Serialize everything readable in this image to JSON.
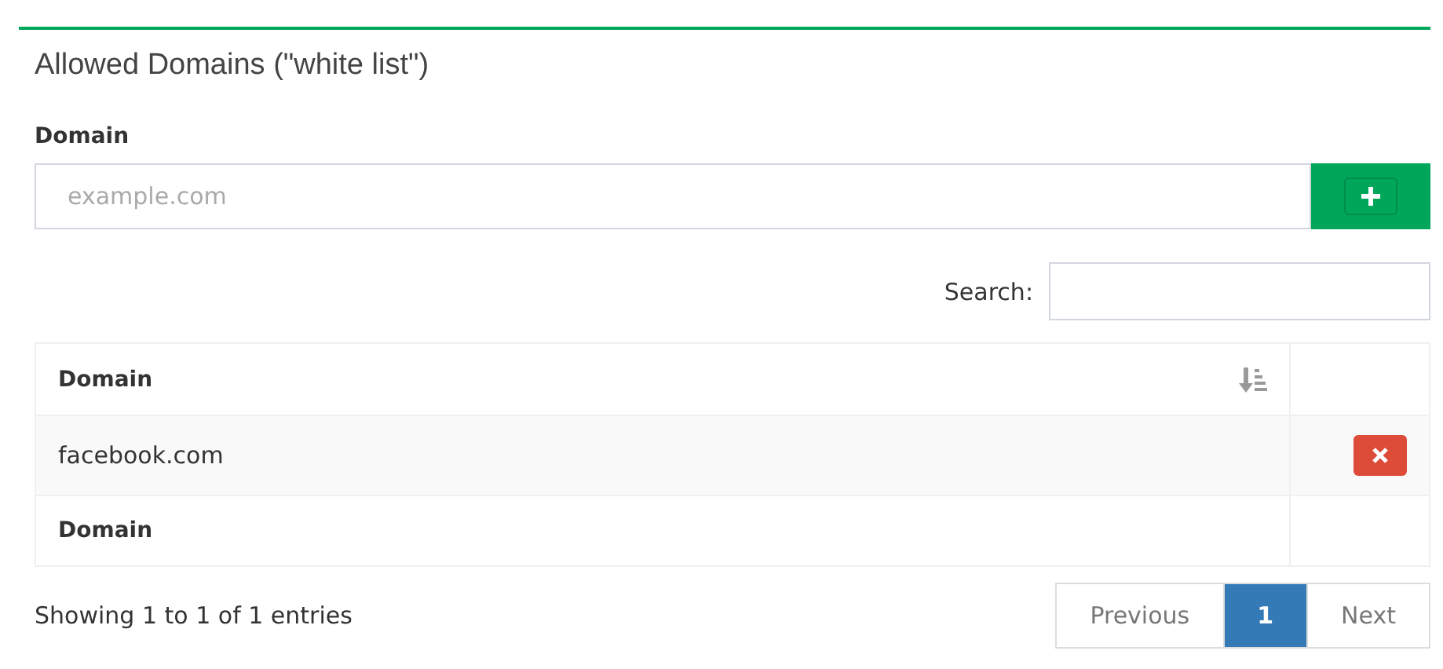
{
  "title": "Allowed Domains (\"white list\")",
  "form": {
    "label": "Domain",
    "placeholder": "example.com"
  },
  "search": {
    "label": "Search:"
  },
  "table": {
    "columns": [
      {
        "label": "Domain",
        "sortable": true
      },
      {
        "sortable": false
      }
    ],
    "rows": [
      {
        "domain": "facebook.com"
      }
    ],
    "footer": [
      "Domain"
    ]
  },
  "info": "Showing 1 to 1 of 1 entries",
  "pagination": [
    {
      "label": "Previous",
      "selected": false,
      "disabled": true
    },
    {
      "label": "1",
      "selected": true,
      "disabled": false
    },
    {
      "label": "Next",
      "selected": false,
      "disabled": true
    }
  ]
}
